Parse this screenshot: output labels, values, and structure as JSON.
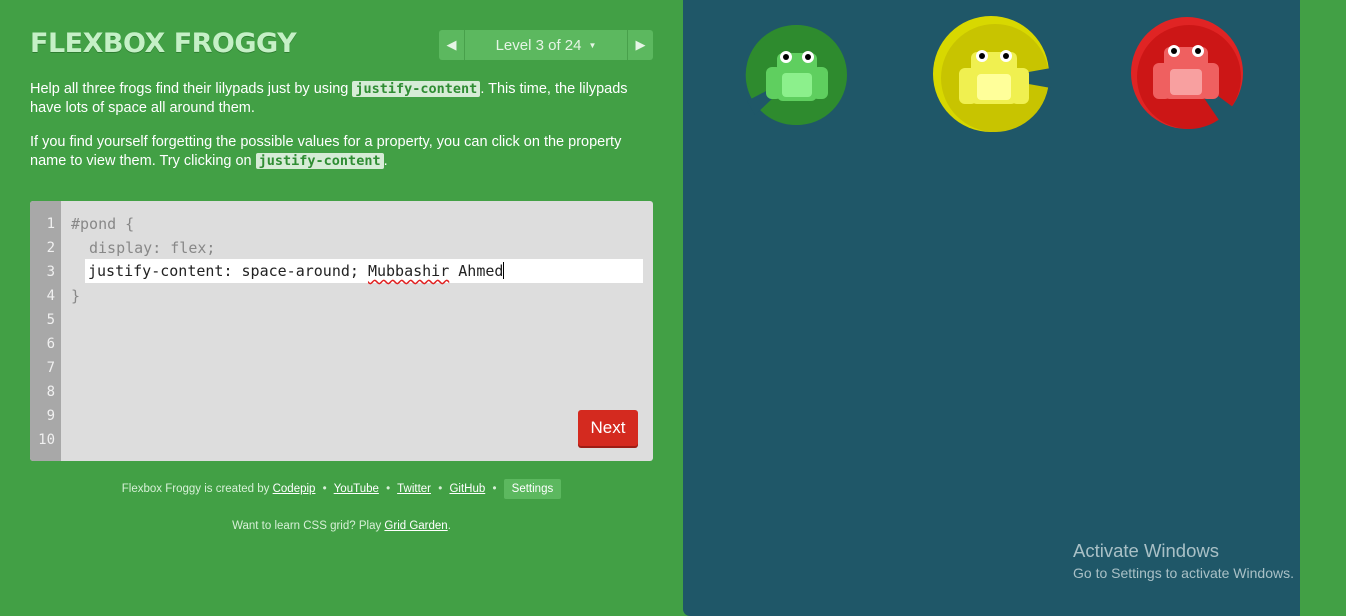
{
  "app": {
    "title": "FLEXBOX FROGGY",
    "level_indicator": "Level 3 of 24",
    "prev_arrow": "◀",
    "next_arrow": "▶",
    "caret": "▼"
  },
  "instructions": {
    "p1_before": "Help all three frogs find their lilypads just by using ",
    "p1_code": "justify-content",
    "p1_after": ". This time, the lilypads have lots of space all around them.",
    "p2_before": "If you find yourself forgetting the possible values for a property, you can click on the property name to view them. Try clicking on ",
    "p2_code": "justify-content",
    "p2_after": "."
  },
  "editor": {
    "line_numbers": [
      "1",
      "2",
      "3",
      "4",
      "5",
      "6",
      "7",
      "8",
      "9",
      "10"
    ],
    "line1": "#pond {",
    "line2": "display: flex;",
    "line4": "}",
    "input_before": "justify-content: space-around; ",
    "input_misspelled": "Mubbashir",
    "input_after": " Ahmed",
    "next_label": "Next"
  },
  "credits": {
    "prefix": "Flexbox Froggy is created by",
    "codepip": "Codepip",
    "youtube": "YouTube",
    "twitter": "Twitter",
    "github": "GitHub",
    "separator": "•",
    "settings": "Settings",
    "grid_prefix": "Want to learn CSS grid? Play",
    "grid_link": "Grid Garden",
    "grid_suffix": "."
  },
  "pond": {
    "frogs": [
      {
        "name": "green",
        "pad_color": "#2e8b2e",
        "body_color": "#5fcf5f",
        "belly_color": "#8cf08c"
      },
      {
        "name": "yellow",
        "pad_color": "#c8c400",
        "body_color": "#f0f050",
        "belly_color": "#ffff9a"
      },
      {
        "name": "red",
        "pad_color": "#d01818",
        "body_color": "#ef6060",
        "belly_color": "#f8a0a0"
      }
    ]
  },
  "watermark": {
    "line1": "Activate Windows",
    "line2": "Go to Settings to activate Windows."
  },
  "colors": {
    "background": "#42a045",
    "pond": "#1f5768",
    "next_button": "#d42a1f"
  }
}
